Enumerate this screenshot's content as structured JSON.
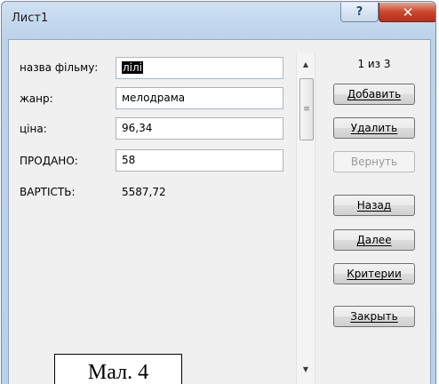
{
  "window": {
    "title": "Лист1",
    "help_glyph": "?",
    "close_glyph": "✕"
  },
  "form": {
    "fields": [
      {
        "label": "назва фільму:",
        "value": "лілі",
        "editable": true,
        "selected": true
      },
      {
        "label": "жанр:",
        "value": "мелодрама",
        "editable": true
      },
      {
        "label": "ціна:",
        "value": "96,34",
        "editable": true
      },
      {
        "label": "ПРОДАНО:",
        "value": "58",
        "editable": true
      },
      {
        "label": "ВАРТІСТЬ:",
        "value": "5587,72",
        "editable": false
      }
    ]
  },
  "scrollbar": {
    "up_arrow": "▲",
    "down_arrow": "▼",
    "thumb_grip": "≡"
  },
  "record_counter": "1 из 3",
  "buttons": {
    "add": "Добавить",
    "delete": "Удалить",
    "restore": "Вернуть",
    "back": "Назад",
    "next": "Далее",
    "criteria": "Критерии",
    "close": "Закрыть"
  },
  "caption": "Мал. 4"
}
